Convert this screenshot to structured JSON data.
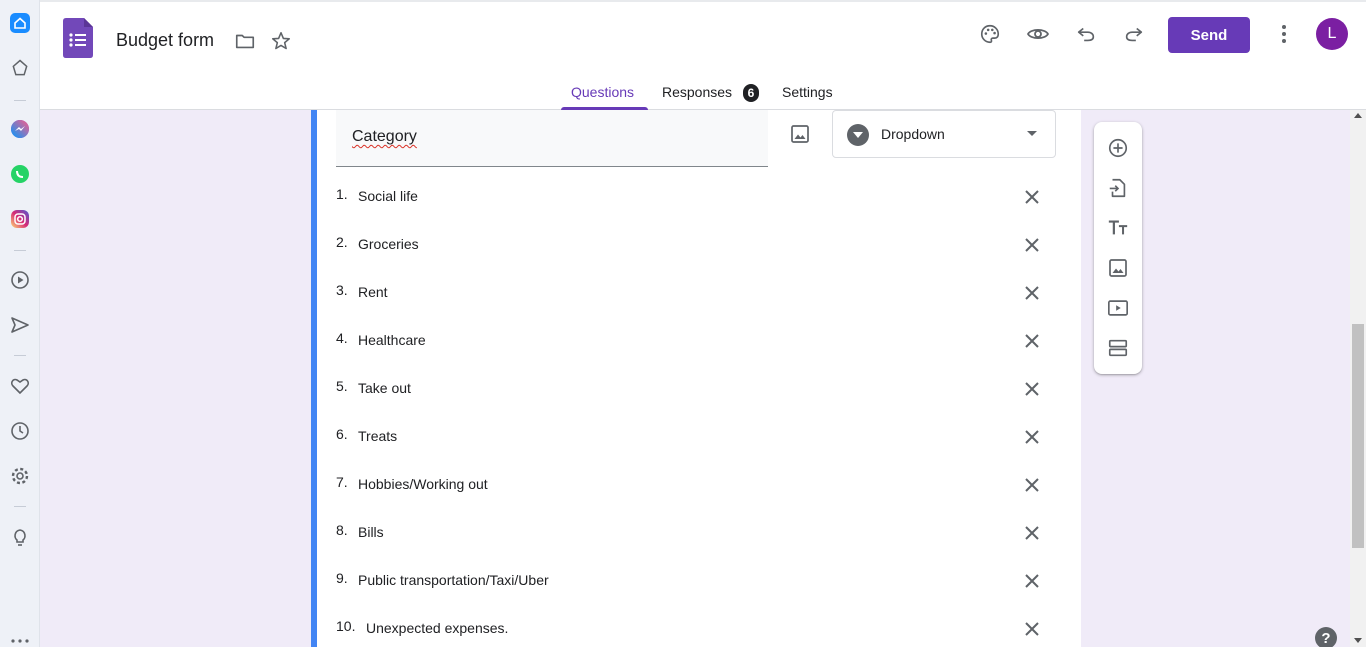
{
  "header": {
    "title": "Budget form",
    "send_label": "Send",
    "avatar_initial": "L"
  },
  "tabs": [
    {
      "label": "Questions",
      "active": true
    },
    {
      "label": "Responses",
      "badge": "6"
    },
    {
      "label": "Settings"
    }
  ],
  "question": {
    "title": "Category",
    "type": "Dropdown",
    "options": [
      {
        "num": "1.",
        "label": "Social life"
      },
      {
        "num": "2.",
        "label": "Groceries"
      },
      {
        "num": "3.",
        "label": "Rent"
      },
      {
        "num": "4.",
        "label": "Healthcare"
      },
      {
        "num": "5.",
        "label": "Take out"
      },
      {
        "num": "6.",
        "label": "Treats"
      },
      {
        "num": "7.",
        "label": "Hobbies/Working out"
      },
      {
        "num": "8.",
        "label": "Bills"
      },
      {
        "num": "9.",
        "label": "Public transportation/Taxi/Uber"
      },
      {
        "num": "10.",
        "label": "Unexpected expenses."
      }
    ]
  },
  "help_label": "?",
  "colors": {
    "accent": "#673ab7",
    "card_accent": "#4285f4",
    "background": "#f0ebf8"
  },
  "icons": {
    "browser_sidebar": [
      "home-icon",
      "bookmarks-icon",
      "messenger-icon",
      "whatsapp-icon",
      "instagram-icon",
      "player-icon",
      "send-icon",
      "heart-icon",
      "history-icon",
      "settings-icon",
      "lightbulb-icon",
      "more-icon"
    ],
    "toolbar": [
      "palette-icon",
      "preview-icon",
      "undo-icon",
      "redo-icon",
      "more-vert-icon"
    ],
    "floating": [
      "add-question-icon",
      "import-questions-icon",
      "add-title-icon",
      "add-image-icon",
      "add-video-icon",
      "add-section-icon"
    ]
  }
}
